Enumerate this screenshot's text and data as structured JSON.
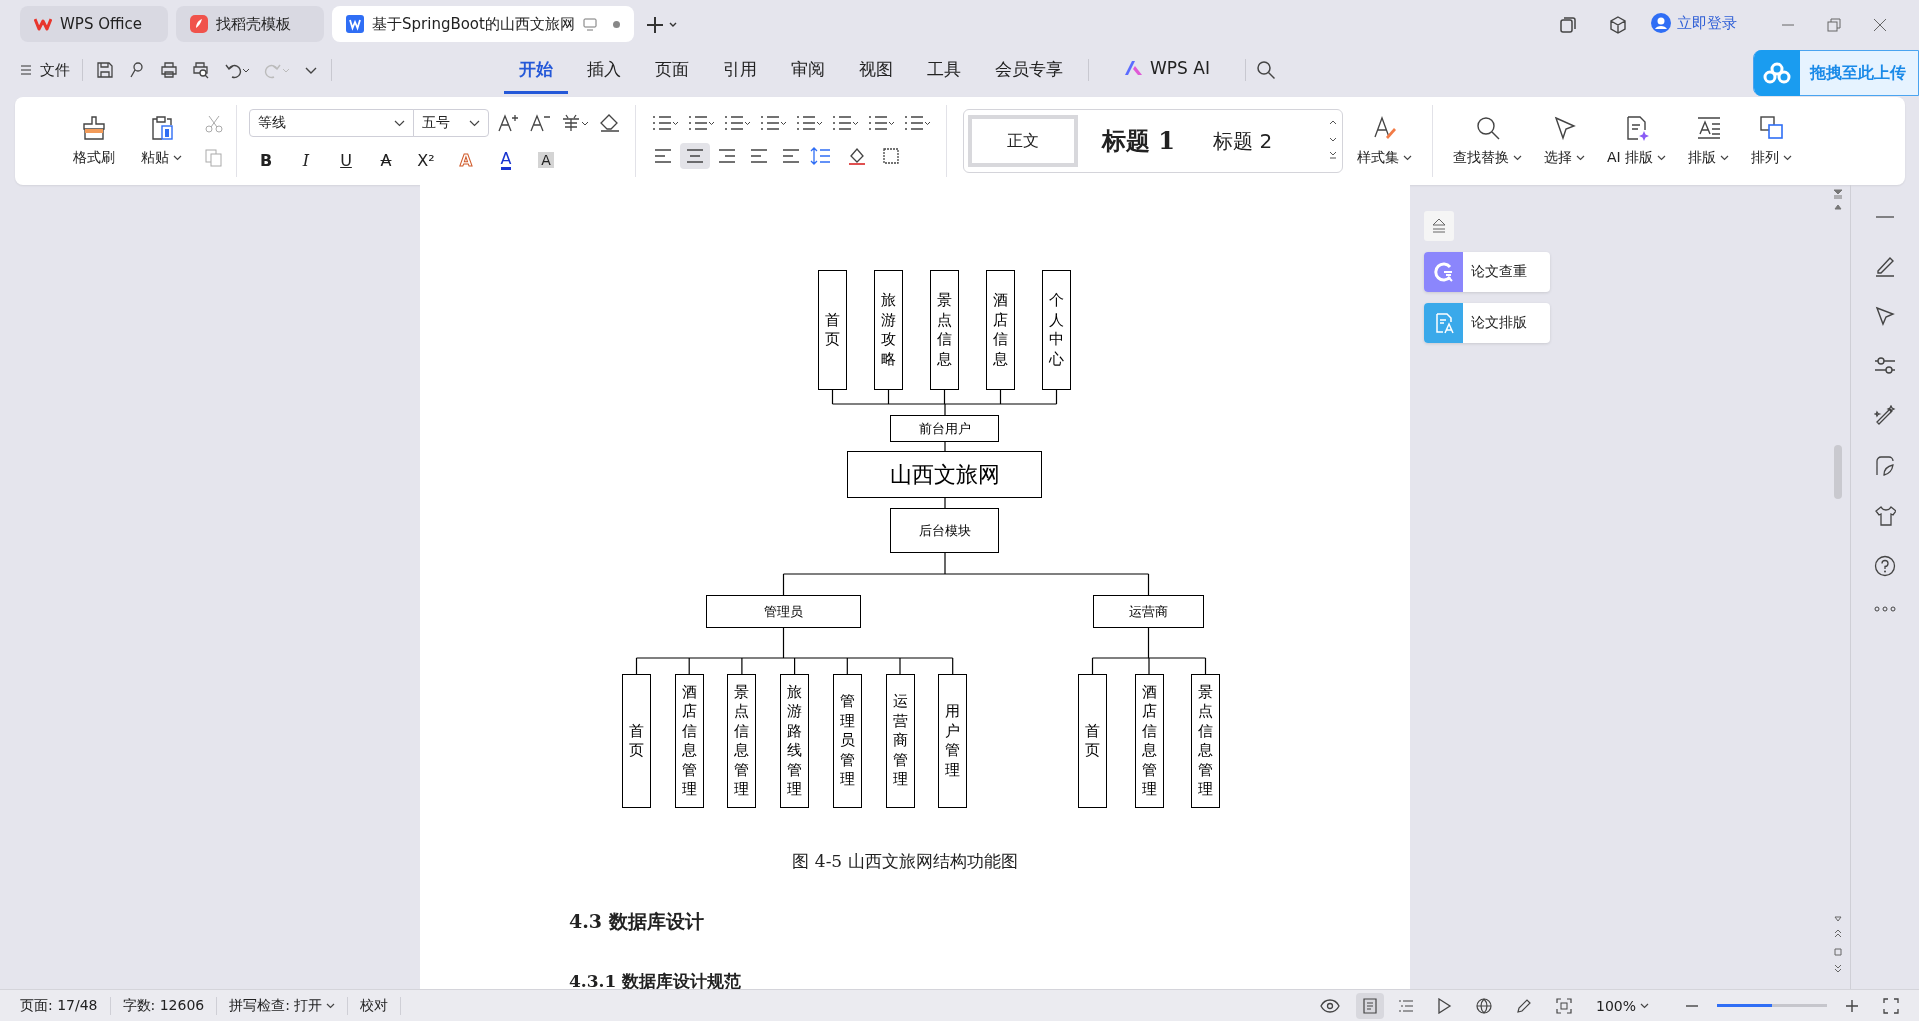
{
  "tabs": [
    {
      "label": "WPS Office",
      "selected": false,
      "kind": "wps"
    },
    {
      "label": "找稻壳模板",
      "selected": false,
      "kind": "docer"
    },
    {
      "label": "基于SpringBoot的山西文旅网",
      "selected": true,
      "kind": "doc"
    }
  ],
  "login": "立即登录",
  "file_menu": "文件",
  "ribbon_tabs": [
    {
      "label": "开始",
      "selected": true
    },
    {
      "label": "插入",
      "selected": false
    },
    {
      "label": "页面",
      "selected": false
    },
    {
      "label": "引用",
      "selected": false
    },
    {
      "label": "审阅",
      "selected": false
    },
    {
      "label": "视图",
      "selected": false
    },
    {
      "label": "工具",
      "selected": false
    },
    {
      "label": "会员专享",
      "selected": false
    }
  ],
  "wps_ai": "WPS AI",
  "upload_button": "拖拽至此上传",
  "ribbon": {
    "clipboard": [
      {
        "label": "格式刷",
        "dropdown": false
      },
      {
        "label": "粘贴",
        "dropdown": true
      }
    ],
    "font": "等线",
    "size": "五号",
    "format_buttons": [
      {
        "label": "B",
        "kind": "bold"
      },
      {
        "label": "I",
        "kind": "italic"
      },
      {
        "label": "U",
        "kind": "underline"
      },
      {
        "label": "A",
        "kind": "strike"
      },
      {
        "label": "X²",
        "kind": "super"
      },
      {
        "label": "A",
        "kind": "effect"
      },
      {
        "label": "A",
        "kind": "color"
      },
      {
        "label": "A",
        "kind": "shade"
      }
    ],
    "paragraph_align": [
      {
        "selected": false
      },
      {
        "selected": true
      },
      {
        "selected": false
      },
      {
        "selected": false
      },
      {
        "selected": false
      }
    ],
    "styles": [
      {
        "label": "正文",
        "selected": true,
        "kind": "body"
      },
      {
        "label": "标题 1",
        "selected": false,
        "kind": "h1"
      },
      {
        "label": "标题 2",
        "selected": false,
        "kind": "h2"
      }
    ],
    "style_set": "样式集",
    "tools": [
      {
        "label": "查找替换",
        "kind": "find"
      },
      {
        "label": "选择",
        "kind": "select"
      },
      {
        "label": "AI 排版",
        "kind": "ai"
      },
      {
        "label": "排版",
        "kind": "layout"
      },
      {
        "label": "排列",
        "kind": "arrange"
      }
    ]
  },
  "side_panel": [
    {
      "label": "论文查重",
      "color": "#8b86fc",
      "kind": "check"
    },
    {
      "label": "论文排版",
      "color": "#3aa9ea",
      "kind": "format"
    }
  ],
  "document": {
    "diagram": {
      "root": "山西文旅网",
      "front": {
        "label": "前台用户",
        "children": [
          "首页",
          "旅游攻略",
          "景点信息",
          "酒店信息",
          "个人中心"
        ]
      },
      "back": {
        "label": "后台模块",
        "children": [
          {
            "label": "管理员",
            "children": [
              "首页",
              "酒店信息管理",
              "景点信息管理",
              "旅游路线管理",
              "管理员管理",
              "运营商管理",
              "用户管理"
            ]
          },
          {
            "label": "运营商",
            "children": [
              "首页",
              "酒店信息管理",
              "景点信息管理"
            ]
          }
        ]
      }
    },
    "caption": "图 4-5 山西文旅网结构功能图",
    "headings": [
      {
        "text": "4.3  数据库设计",
        "kind": "h2"
      },
      {
        "text": "4.3.1  数据库设计规范",
        "kind": "h3"
      }
    ]
  },
  "status_bar": {
    "items": [
      "页面: 17/48",
      "字数: 12606"
    ],
    "spell": "拼写检查: 打开",
    "proof": "校对",
    "view_modes": [
      {
        "selected": true
      },
      {
        "selected": false
      }
    ],
    "zoom": "100%",
    "zoom_slider": {
      "level": 0.5
    }
  }
}
